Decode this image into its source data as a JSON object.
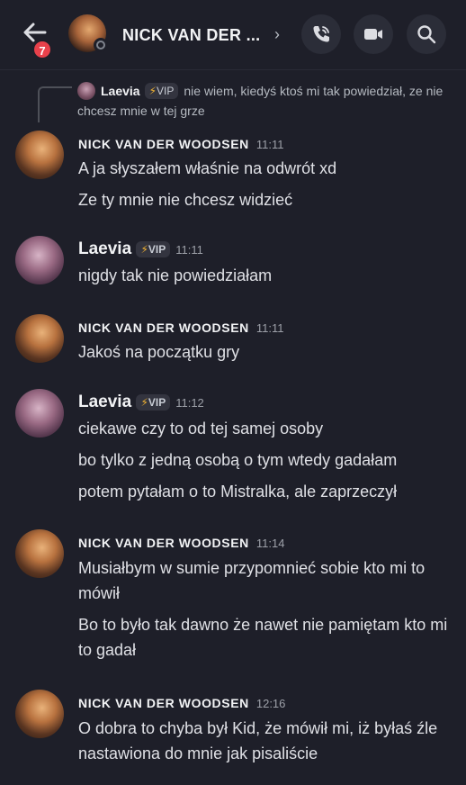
{
  "header": {
    "unread_count": "7",
    "title": "NICK VAN DER ...",
    "chevron": "›",
    "icons": [
      "back-arrow-icon",
      "phone-call-icon",
      "video-camera-icon",
      "search-icon"
    ]
  },
  "reply": {
    "author": "Laevia",
    "badge_bolt": "⚡",
    "badge_text": "VIP",
    "text": "nie wiem, kiedyś ktoś mi tak powiedział, ze nie chcesz mnie w tej grze"
  },
  "messages": [
    {
      "author": "NICK VAN DER WOODSEN",
      "time": "11:11",
      "lines": [
        "A ja słyszałem właśnie na odwrót xd",
        "Ze ty mnie nie chcesz widzieć"
      ]
    },
    {
      "author": "Laevia",
      "badge_bolt": "⚡",
      "badge_text": "VIP",
      "time": "11:11",
      "lines": [
        "nigdy tak nie powiedziałam"
      ]
    },
    {
      "author": "NICK VAN DER WOODSEN",
      "time": "11:11",
      "lines": [
        "Jakoś na początku gry"
      ]
    },
    {
      "author": "Laevia",
      "badge_bolt": "⚡",
      "badge_text": "VIP",
      "time": "11:12",
      "lines": [
        "ciekawe czy to od tej samej osoby",
        "bo tylko z jedną osobą o tym wtedy gadałam",
        "potem pytałam o to Mistralka, ale zaprzeczył"
      ]
    },
    {
      "author": "NICK VAN DER WOODSEN",
      "time": "11:14",
      "lines": [
        "Musiałbym w sumie przypomnieć sobie kto mi to mówił",
        "Bo to było tak dawno że nawet nie pamiętam kto mi to gadał"
      ]
    },
    {
      "author": "NICK VAN DER WOODSEN",
      "time": "12:16",
      "lines": [
        "O dobra to chyba był Kid, że mówił mi, iż byłaś źle nastawiona do mnie jak pisaliście"
      ]
    }
  ]
}
